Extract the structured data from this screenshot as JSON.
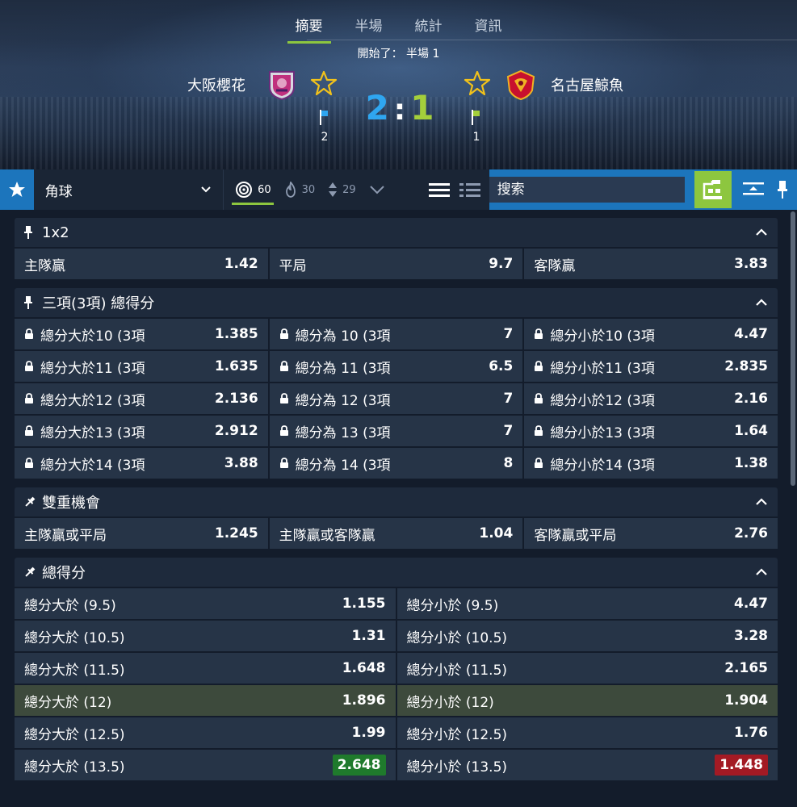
{
  "header": {
    "tabs": [
      "摘要",
      "半場",
      "統計",
      "資訊"
    ],
    "active_tab": 0,
    "status": "開始了： 半場 1",
    "home_team": "大阪櫻花",
    "away_team": "名古屋鯨魚",
    "home_score": "2",
    "away_score": "1",
    "score_sep": ":",
    "home_corners": "2",
    "away_corners": "1",
    "home_color": "#2fa6f0",
    "away_color": "#a4cf3b"
  },
  "toolbar": {
    "market_select": "角球",
    "stat_all": "60",
    "stat_hot": "30",
    "stat_move": "29",
    "search_placeholder": "搜索"
  },
  "markets": {
    "m1x2": {
      "title": "1x2",
      "rows": [
        [
          {
            "label": "主隊贏",
            "odd": "1.42"
          },
          {
            "label": "平局",
            "odd": "9.7"
          },
          {
            "label": "客隊贏",
            "odd": "3.83"
          }
        ]
      ]
    },
    "three_way": {
      "title": "三項(3項) 總得分",
      "rows": [
        [
          {
            "label": "總分大於10 (3項",
            "odd": "1.385"
          },
          {
            "label": "總分為 10 (3項",
            "odd": "7"
          },
          {
            "label": "總分小於10 (3項",
            "odd": "4.47"
          }
        ],
        [
          {
            "label": "總分大於11 (3項",
            "odd": "1.635"
          },
          {
            "label": "總分為 11 (3項",
            "odd": "6.5"
          },
          {
            "label": "總分小於11 (3項",
            "odd": "2.835"
          }
        ],
        [
          {
            "label": "總分大於12 (3項",
            "odd": "2.136"
          },
          {
            "label": "總分為 12 (3項",
            "odd": "7"
          },
          {
            "label": "總分小於12 (3項",
            "odd": "2.16"
          }
        ],
        [
          {
            "label": "總分大於13 (3項",
            "odd": "2.912"
          },
          {
            "label": "總分為 13 (3項",
            "odd": "7"
          },
          {
            "label": "總分小於13 (3項",
            "odd": "1.64"
          }
        ],
        [
          {
            "label": "總分大於14 (3項",
            "odd": "3.88"
          },
          {
            "label": "總分為 14 (3項",
            "odd": "8"
          },
          {
            "label": "總分小於14 (3項",
            "odd": "1.38"
          }
        ]
      ]
    },
    "double_chance": {
      "title": "雙重機會",
      "rows": [
        [
          {
            "label": "主隊贏或平局",
            "odd": "1.245"
          },
          {
            "label": "主隊贏或客隊贏",
            "odd": "1.04"
          },
          {
            "label": "客隊贏或平局",
            "odd": "2.76"
          }
        ]
      ]
    },
    "total": {
      "title": "總得分",
      "rows": [
        [
          {
            "label": "總分大於 (9.5)",
            "odd": "1.155"
          },
          {
            "label": "總分小於 (9.5)",
            "odd": "4.47"
          }
        ],
        [
          {
            "label": "總分大於 (10.5)",
            "odd": "1.31"
          },
          {
            "label": "總分小於 (10.5)",
            "odd": "3.28"
          }
        ],
        [
          {
            "label": "總分大於 (11.5)",
            "odd": "1.648"
          },
          {
            "label": "總分小於 (11.5)",
            "odd": "2.165"
          }
        ],
        [
          {
            "label": "總分大於 (12)",
            "odd": "1.896"
          },
          {
            "label": "總分小於 (12)",
            "odd": "1.904"
          }
        ],
        [
          {
            "label": "總分大於 (12.5)",
            "odd": "1.99"
          },
          {
            "label": "總分小於 (12.5)",
            "odd": "1.76"
          }
        ],
        [
          {
            "label": "總分大於 (13.5)",
            "odd": "2.648"
          },
          {
            "label": "總分小於 (13.5)",
            "odd": "1.448"
          }
        ]
      ],
      "highlight_row": 3,
      "odd_up_color": "#1f7a2c",
      "odd_down_color": "#a31a24"
    }
  }
}
